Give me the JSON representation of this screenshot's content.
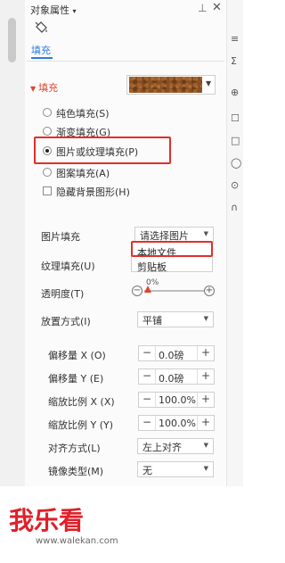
{
  "panel": {
    "title": "对象属性",
    "title_caret": "▾",
    "pin_icon": "⊥",
    "close_icon": "✕",
    "tab_label": "填充"
  },
  "fill_section": {
    "header": "填充",
    "options": [
      {
        "label": "纯色填充(S)",
        "selected": false
      },
      {
        "label": "渐变填充(G)",
        "selected": false
      },
      {
        "label": "图片或纹理填充(P)",
        "selected": true
      },
      {
        "label": "图案填充(A)",
        "selected": false
      }
    ],
    "hide_bg_label": "隐藏背景图形(H)"
  },
  "image_fill": {
    "label": "图片填充",
    "select_value": "请选择图片",
    "menu_items": [
      "本地文件",
      "剪贴板"
    ]
  },
  "texture_fill": {
    "label": "纹理填充(U)"
  },
  "transparency": {
    "label": "透明度(T)",
    "value": "0%",
    "minus": "−",
    "plus": "+"
  },
  "placement": {
    "label": "放置方式(I)",
    "value": "平铺"
  },
  "offset_x": {
    "label": "偏移量 X (O)",
    "value": "0.0磅"
  },
  "offset_y": {
    "label": "偏移量 Y (E)",
    "value": "0.0磅"
  },
  "scale_x": {
    "label": "缩放比例 X (X)",
    "value": "100.0%"
  },
  "scale_y": {
    "label": "缩放比例 Y (Y)",
    "value": "100.0%"
  },
  "align": {
    "label": "对齐方式(L)",
    "value": "左上对齐"
  },
  "mirror": {
    "label": "镜像类型(M)",
    "value": "无"
  },
  "spin": {
    "minus": "−",
    "plus": "+"
  },
  "right_edge": [
    "≡",
    "Σ",
    "⊕",
    "☐",
    "□",
    "◯",
    "⊙",
    "∩"
  ],
  "watermark": {
    "logo": "我乐看",
    "url": "www.walekan.com"
  },
  "colors": {
    "accent_red": "#e0302a",
    "accent_blue": "#2c7be5"
  }
}
